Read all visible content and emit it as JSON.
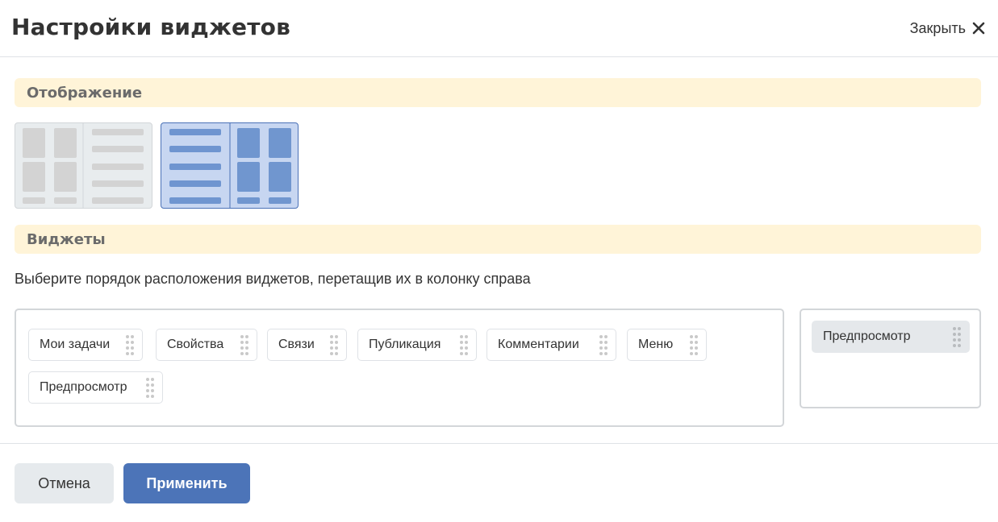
{
  "dialog": {
    "title": "Настройки виджетов",
    "close_label": "Закрыть",
    "close_icon": "close-icon"
  },
  "sections": {
    "display": "Отображение",
    "widgets": "Виджеты"
  },
  "layout_options": [
    {
      "name": "widgets-left-list-right",
      "selected": false
    },
    {
      "name": "list-left-widgets-right",
      "selected": true
    }
  ],
  "instruction": "Выберите порядок расположения виджетов, перетащив их в колонку справа",
  "available_widgets": [
    "Мои задачи",
    "Свойства",
    "Связи",
    "Публикация",
    "Комментарии",
    "Меню",
    "Предпросмотр"
  ],
  "selected_widgets": [
    "Предпросмотр"
  ],
  "buttons": {
    "cancel": "Отмена",
    "apply": "Применить"
  },
  "colors": {
    "section_bg": "#fff4d8",
    "primary": "#4c74b8",
    "selected_layout_bg": "#c7d6f1"
  }
}
